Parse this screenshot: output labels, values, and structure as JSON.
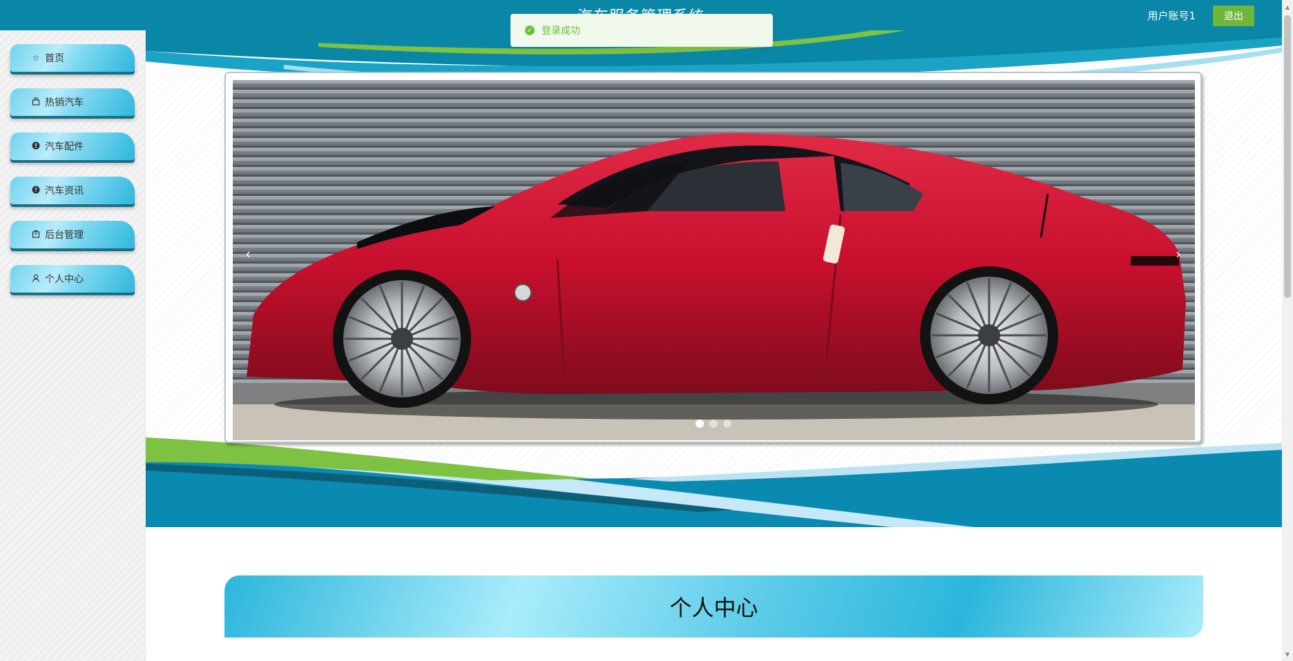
{
  "header": {
    "title": "汽车服务管理系统",
    "user_label": "用户账号1",
    "logout_label": "退出"
  },
  "toast": {
    "message": "登录成功"
  },
  "sidebar": {
    "items": [
      {
        "label": "首页",
        "icon": "star-icon"
      },
      {
        "label": "热销汽车",
        "icon": "bag-icon"
      },
      {
        "label": "汽车配件",
        "icon": "info-icon"
      },
      {
        "label": "汽车资讯",
        "icon": "question-icon"
      },
      {
        "label": "后台管理",
        "icon": "box-icon"
      },
      {
        "label": "个人中心",
        "icon": "user-icon"
      }
    ]
  },
  "carousel": {
    "prev": "‹",
    "next": "›",
    "slide_count": 3,
    "active_index": 0
  },
  "section": {
    "title": "个人中心"
  },
  "colors": {
    "header": "#0a87a6",
    "accent_green": "#6fb63b",
    "nav_cyan": "#2eb7de",
    "success": "#67c23a"
  }
}
